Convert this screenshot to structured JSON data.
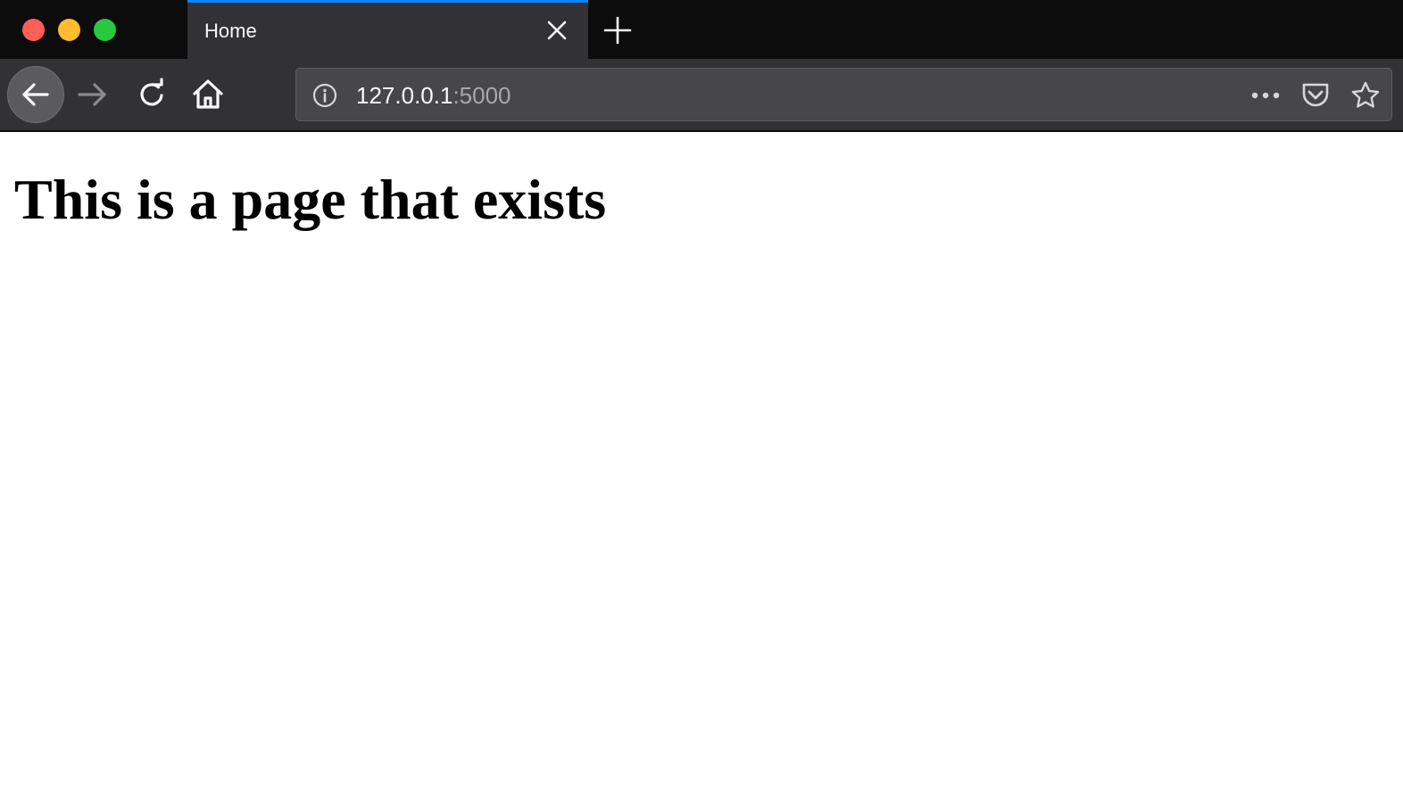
{
  "window": {
    "traffic_lights": {
      "close": "#fe5f57",
      "minimize": "#febc2e",
      "maximize": "#28c840"
    }
  },
  "tab": {
    "title": "Home",
    "accent_color": "#0a84ff",
    "close_icon": "close-icon"
  },
  "new_tab": {
    "icon": "plus-icon"
  },
  "toolbar": {
    "back_icon": "arrow-left-icon",
    "forward_icon": "arrow-right-icon",
    "reload_icon": "reload-icon",
    "home_icon": "home-icon"
  },
  "urlbar": {
    "host": "127.0.0.1",
    "port": ":5000",
    "info_icon": "info-icon",
    "page_actions_icon": "ellipsis-icon",
    "pocket_icon": "pocket-icon",
    "bookmark_icon": "star-icon"
  },
  "page": {
    "heading": "This is a page that exists"
  }
}
